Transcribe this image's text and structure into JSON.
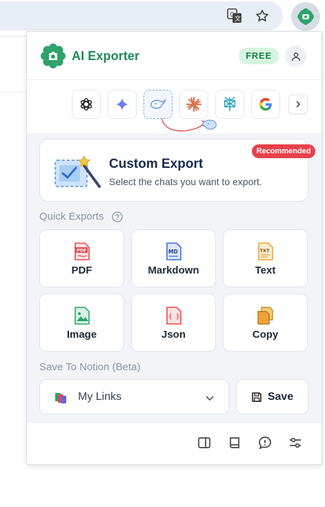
{
  "app": {
    "title": "AI Exporter",
    "plan_badge": "FREE",
    "accent": "#1e8a5a"
  },
  "platforms": [
    {
      "name": "ChatGPT",
      "icon": "openai-icon"
    },
    {
      "name": "Gemini",
      "icon": "gemini-sparkle-icon"
    },
    {
      "name": "DeepSeek",
      "icon": "deepseek-whale-icon",
      "selected": true
    },
    {
      "name": "Claude",
      "icon": "claude-asterisk-icon"
    },
    {
      "name": "Perplexity",
      "icon": "perplexity-icon"
    },
    {
      "name": "Google",
      "icon": "google-g-icon"
    }
  ],
  "custom_export": {
    "badge": "Recommended",
    "title": "Custom Export",
    "subtitle": "Select the chats you want to export."
  },
  "quick_exports": {
    "label": "Quick Exports",
    "items": [
      {
        "label": "PDF",
        "icon": "pdf-file-icon",
        "color": "#e5484d"
      },
      {
        "label": "Markdown",
        "icon": "markdown-file-icon",
        "color": "#3b6fd8"
      },
      {
        "label": "Text",
        "icon": "txt-file-icon",
        "color": "#f0a23a"
      },
      {
        "label": "Image",
        "icon": "image-file-icon",
        "color": "#2fa36b"
      },
      {
        "label": "Json",
        "icon": "json-file-icon",
        "color": "#e5484d"
      },
      {
        "label": "Copy",
        "icon": "copy-icon",
        "color": "#f0a23a"
      }
    ]
  },
  "notion": {
    "label": "Save To Notion (Beta)",
    "selected_page": "My Links",
    "save_label": "Save"
  },
  "footer": {
    "icons": [
      "sidebar-panel-icon",
      "book-icon",
      "feedback-icon",
      "settings-sliders-icon"
    ]
  }
}
